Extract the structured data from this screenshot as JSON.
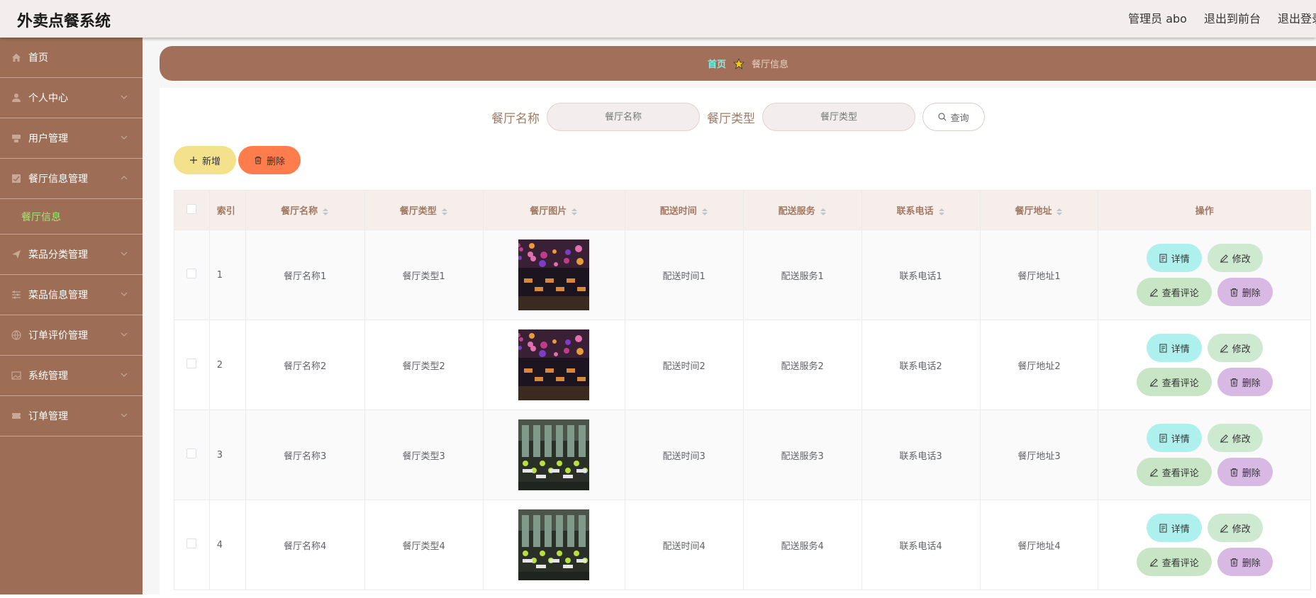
{
  "header": {
    "app_title": "外卖点餐系统",
    "admin_label": "管理员 abo",
    "back_to_front": "退出到前台",
    "logout": "退出登录"
  },
  "sidebar": {
    "items": [
      {
        "label": "首页",
        "icon": "home-icon"
      },
      {
        "label": "个人中心",
        "icon": "user-icon"
      },
      {
        "label": "用户管理",
        "icon": "users-icon"
      },
      {
        "label": "餐厅信息管理",
        "icon": "list-icon",
        "expanded": true
      },
      {
        "label": "菜品分类管理",
        "icon": "send-icon"
      },
      {
        "label": "菜品信息管理",
        "icon": "sliders-icon"
      },
      {
        "label": "订单评价管理",
        "icon": "globe-icon"
      },
      {
        "label": "系统管理",
        "icon": "image-icon"
      },
      {
        "label": "订单管理",
        "icon": "ticket-icon"
      }
    ],
    "sub_item": "餐厅信息"
  },
  "breadcrumb": {
    "home": "首页",
    "current": "餐厅信息"
  },
  "search": {
    "name_label": "餐厅名称",
    "name_placeholder": "餐厅名称",
    "type_label": "餐厅类型",
    "type_placeholder": "餐厅类型",
    "query_button": "查询"
  },
  "actions": {
    "add": "新增",
    "delete": "删除"
  },
  "table": {
    "headers": [
      "索引",
      "餐厅名称",
      "餐厅类型",
      "餐厅图片",
      "配送时间",
      "配送服务",
      "联系电话",
      "餐厅地址",
      "操作"
    ],
    "rows": [
      {
        "index": "1",
        "name": "餐厅名称1",
        "type": "餐厅类型1",
        "time": "配送时间1",
        "service": "配送服务1",
        "phone": "联系电话1",
        "address": "餐厅地址1"
      },
      {
        "index": "2",
        "name": "餐厅名称2",
        "type": "餐厅类型2",
        "time": "配送时间2",
        "service": "配送服务2",
        "phone": "联系电话2",
        "address": "餐厅地址2"
      },
      {
        "index": "3",
        "name": "餐厅名称3",
        "type": "餐厅类型3",
        "time": "配送时间3",
        "service": "配送服务3",
        "phone": "联系电话3",
        "address": "餐厅地址3"
      },
      {
        "index": "4",
        "name": "餐厅名称4",
        "type": "餐厅类型4",
        "time": "配送时间4",
        "service": "配送服务4",
        "phone": "联系电话4",
        "address": "餐厅地址4"
      }
    ],
    "row_actions": {
      "detail": "详情",
      "edit": "修改",
      "comments": "查看评论",
      "delete": "删除"
    }
  },
  "colors": {
    "sidebar_bg": "#9d6e55",
    "breadcrumb_bg": "#a2705a",
    "active_sub": "#9fe870",
    "add_button": "#f3e18b",
    "delete_button": "#ff7c4c"
  }
}
